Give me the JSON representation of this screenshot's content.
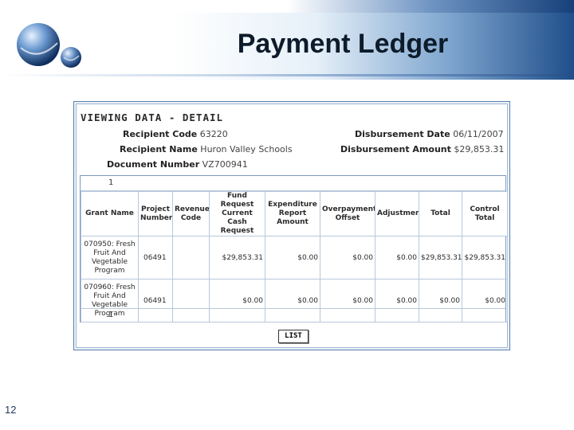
{
  "slide": {
    "title": "Payment Ledger",
    "page_number": "12"
  },
  "view": {
    "title": "VIEWING DATA - DETAIL",
    "recipient_code_label": "Recipient Code",
    "recipient_code": "63220",
    "recipient_name_label": "Recipient Name",
    "recipient_name": "Huron Valley Schools",
    "document_number_label": "Document Number",
    "document_number": "VZ700941",
    "disbursement_date_label": "Disbursement Date",
    "disbursement_date": "06/11/2007",
    "disbursement_amount_label": "Disbursement Amount",
    "disbursement_amount": "$29,853.31"
  },
  "table": {
    "page_indicator_top": "1",
    "page_indicator_bottom": "1",
    "headers": [
      "Grant Name",
      "Project Number",
      "Revenue Code",
      "Fund Request Current Cash Request",
      "Expenditure Report Amount",
      "Overpayment Offset",
      "Adjustment",
      "Total",
      "Control Total"
    ],
    "rows": [
      {
        "grant_name": "070950: Fresh Fruit And Vegetable Program",
        "project_number": "06491",
        "revenue_code": "",
        "cash_request": "$29,853.31",
        "expenditure": "$0.00",
        "overpayment": "$0.00",
        "adjustment": "$0.00",
        "total": "$29,853.31",
        "control_total": "$29,853.31"
      },
      {
        "grant_name": "070960: Fresh Fruit And Vegetable Program",
        "project_number": "06491",
        "revenue_code": "",
        "cash_request": "$0.00",
        "expenditure": "$0.00",
        "overpayment": "$0.00",
        "adjustment": "$0.00",
        "total": "$0.00",
        "control_total": "$0.00"
      }
    ]
  },
  "buttons": {
    "list_label": "LIST"
  },
  "icons": {
    "logo": "globe-logo-icon"
  },
  "colors": {
    "header_dark": "#1f4e8a",
    "frame_border": "#5a7fb0",
    "table_border": "#b8c8dc"
  }
}
